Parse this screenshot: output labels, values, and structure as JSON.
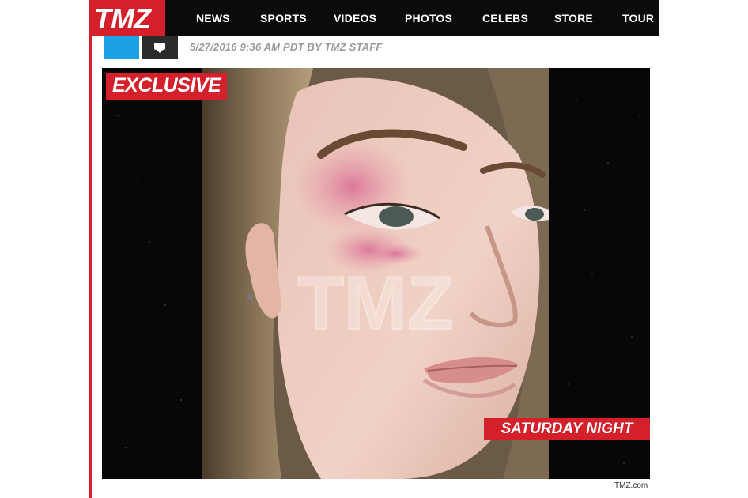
{
  "header": {
    "logo_text": "TMZ",
    "nav": [
      "NEWS",
      "SPORTS",
      "VIDEOS",
      "PHOTOS",
      "CELEBS",
      "STORE",
      "TOUR"
    ]
  },
  "article": {
    "dateline": "5/27/2016 9:36 AM PDT BY TMZ STAFF"
  },
  "media": {
    "badge_top": "EXCLUSIVE",
    "badge_bottom": "SATURDAY NIGHT",
    "watermark": "TMZ",
    "credit": "TMZ.com"
  },
  "colors": {
    "brand_red": "#d3202a",
    "nav_bg": "#0b0b0b",
    "share_blue": "#1da1e4"
  },
  "icons": [
    "facebook-share-icon",
    "comment-icon"
  ]
}
